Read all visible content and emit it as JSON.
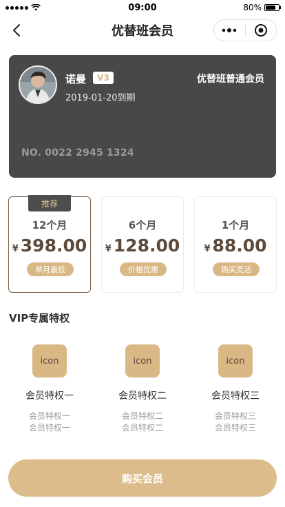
{
  "status_bar": {
    "time": "09:00",
    "battery_text": "80%",
    "battery_level": 0.8
  },
  "nav": {
    "title": "优替班会员"
  },
  "member_card": {
    "name": "诺曼",
    "level": "V3",
    "expiry": "2019-01-20到期",
    "membership_type": "优替班普通会员",
    "card_number": "NO. 0022 2945 1324"
  },
  "plans": [
    {
      "tag": "推荐",
      "duration": "12个月",
      "currency": "¥",
      "price": "398.00",
      "note": "单月最低",
      "selected": true
    },
    {
      "tag": "",
      "duration": "6个月",
      "currency": "¥",
      "price": "128.00",
      "note": "价格优惠",
      "selected": false
    },
    {
      "tag": "",
      "duration": "1个月",
      "currency": "¥",
      "price": "88.00",
      "note": "购买灵活",
      "selected": false
    }
  ],
  "privileges": {
    "title": "VIP专属特权",
    "items": [
      {
        "icon_label": "icon",
        "title": "会员特权一",
        "desc_line1": "会员特权一",
        "desc_line2": "会员特权一"
      },
      {
        "icon_label": "icon",
        "title": "会员特权二",
        "desc_line1": "会员特权二",
        "desc_line2": "会员特权二"
      },
      {
        "icon_label": "icon",
        "title": "会员特权三",
        "desc_line1": "会员特权三",
        "desc_line2": "会员特权三"
      }
    ]
  },
  "buy_button": {
    "label": "购买会员"
  },
  "colors": {
    "gold": "#d9b886",
    "card_bg": "#484848",
    "price_brown": "#5c4a3b"
  }
}
